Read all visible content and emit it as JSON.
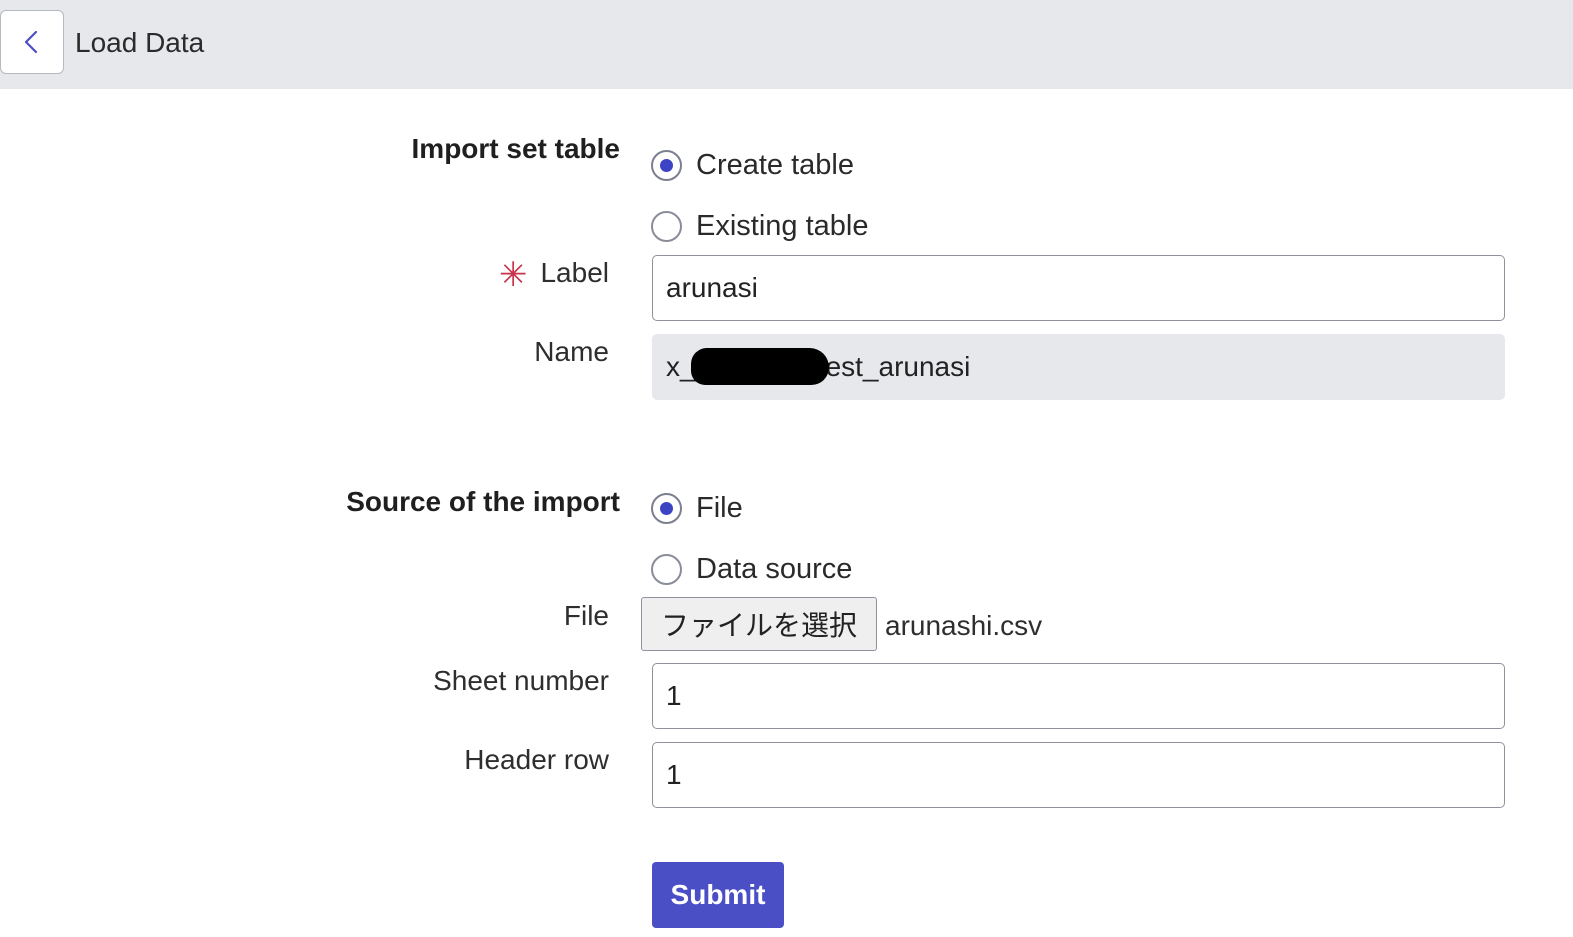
{
  "header": {
    "title": "Load Data",
    "back_icon": "chevron-left-icon"
  },
  "import_set_table": {
    "label": "Import set table",
    "options": [
      {
        "label": "Create table",
        "checked": true
      },
      {
        "label": "Existing table",
        "checked": false
      }
    ]
  },
  "label_field": {
    "label": "Label",
    "required": true,
    "value": "arunasi"
  },
  "name_field": {
    "label": "Name",
    "value_prefix": "x_",
    "value_suffix": "est_arunasi",
    "readonly": true
  },
  "source_of_import": {
    "label": "Source of the import",
    "options": [
      {
        "label": "File",
        "checked": true
      },
      {
        "label": "Data source",
        "checked": false
      }
    ]
  },
  "file_field": {
    "label": "File",
    "button_label": "ファイルを選択",
    "selected_file": "arunashi.csv"
  },
  "sheet_number": {
    "label": "Sheet number",
    "value": "1"
  },
  "header_row": {
    "label": "Header row",
    "value": "1"
  },
  "submit": {
    "label": "Submit"
  },
  "colors": {
    "accent": "#4a4fc6",
    "header_bg": "#e6e8eb",
    "required": "#c8324a"
  }
}
